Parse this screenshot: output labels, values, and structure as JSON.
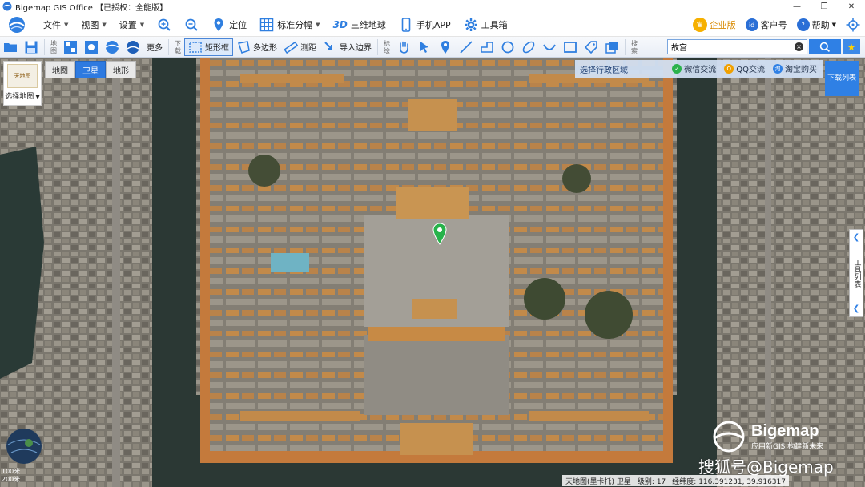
{
  "window": {
    "title": "Bigemap GIS Office 【已授权：全能版】",
    "controls": [
      "—",
      "❐",
      "✕"
    ]
  },
  "menu": {
    "file": "文件",
    "view": "视图",
    "settings": "设置",
    "locate": "定位",
    "standard_tiles": "标准分幅",
    "globe3d_prefix": "3D",
    "globe3d": "三维地球",
    "mobile_app": "手机APP",
    "toolbox": "工具箱",
    "enterprise": "企业版",
    "account": "客户号",
    "help": "帮助"
  },
  "toolbar": {
    "group_map_label": "地图",
    "more": "更多",
    "group_download_label": "下载",
    "rectangle": "矩形框",
    "polygon": "多边形",
    "measure": "测距",
    "import_boundary": "导入边界",
    "group_mark_label": "标绘",
    "group_search_label": "搜索",
    "search_value": "故宫",
    "search_placeholder": "搜索"
  },
  "map": {
    "layer_thumb_text": "天地图",
    "select_map_label": "选择地图",
    "tabs": [
      {
        "label": "地图",
        "active": false
      },
      {
        "label": "卫星",
        "active": true
      },
      {
        "label": "地形",
        "active": false
      }
    ],
    "region_select": "选择行政区域",
    "contacts": [
      {
        "label": "微信交流",
        "color": "#2bb24c"
      },
      {
        "label": "QQ交流",
        "color": "#f0a000"
      },
      {
        "label": "淘宝购买",
        "color": "#2f80e5"
      }
    ],
    "download_list": "下载列表",
    "tool_list": "工具列表",
    "scale_labels": [
      "100米",
      "200米"
    ],
    "status": {
      "source": "天地图(墨卡托) 卫星",
      "level_label": "级别:",
      "level": "17",
      "coords_label": "经纬度:",
      "coords": "116.391231, 39.916317"
    },
    "watermark_brand": "Bigemap",
    "watermark_slogan": "应用新GIS 构建新未来",
    "watermark_text": "搜狐号@Bigemap"
  }
}
